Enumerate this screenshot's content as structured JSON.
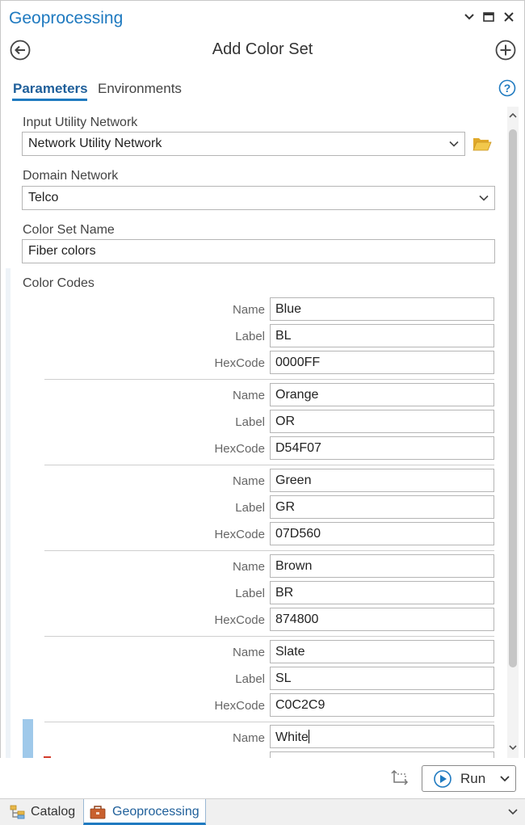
{
  "window": {
    "title": "Geoprocessing",
    "icons": [
      "chevron-down-icon",
      "maximize-icon",
      "close-icon"
    ]
  },
  "header": {
    "tool_title": "Add Color Set",
    "back_icon": "arrow-left-circle-icon",
    "add_icon": "plus-circle-icon"
  },
  "tabs": {
    "parameters": "Parameters",
    "environments": "Environments",
    "help_icon": "help-circle-icon"
  },
  "params": {
    "input_utility_network": {
      "label": "Input Utility Network",
      "value": "Network Utility Network"
    },
    "domain_network": {
      "label": "Domain Network",
      "value": "Telco"
    },
    "color_set_name": {
      "label": "Color Set Name",
      "value": "Fiber colors"
    },
    "color_codes": {
      "label": "Color Codes",
      "field_labels": {
        "name": "Name",
        "label": "Label",
        "hexcode": "HexCode"
      },
      "rows": [
        {
          "name": "Blue",
          "label": "BL",
          "hexcode": "0000FF"
        },
        {
          "name": "Orange",
          "label": "OR",
          "hexcode": "D54F07"
        },
        {
          "name": "Green",
          "label": "GR",
          "hexcode": "07D560"
        },
        {
          "name": "Brown",
          "label": "BR",
          "hexcode": "874800"
        },
        {
          "name": "Slate",
          "label": "SL",
          "hexcode": "C0C2C9"
        },
        {
          "name": "White"
        }
      ]
    }
  },
  "footer": {
    "run_label": "Run"
  },
  "bottom_tabs": {
    "catalog": "Catalog",
    "geoprocessing": "Geoprocessing"
  },
  "colors": {
    "accent": "#1f7ac0",
    "active_row": "#9fc9ea",
    "error_mark": "#d23a2a"
  }
}
